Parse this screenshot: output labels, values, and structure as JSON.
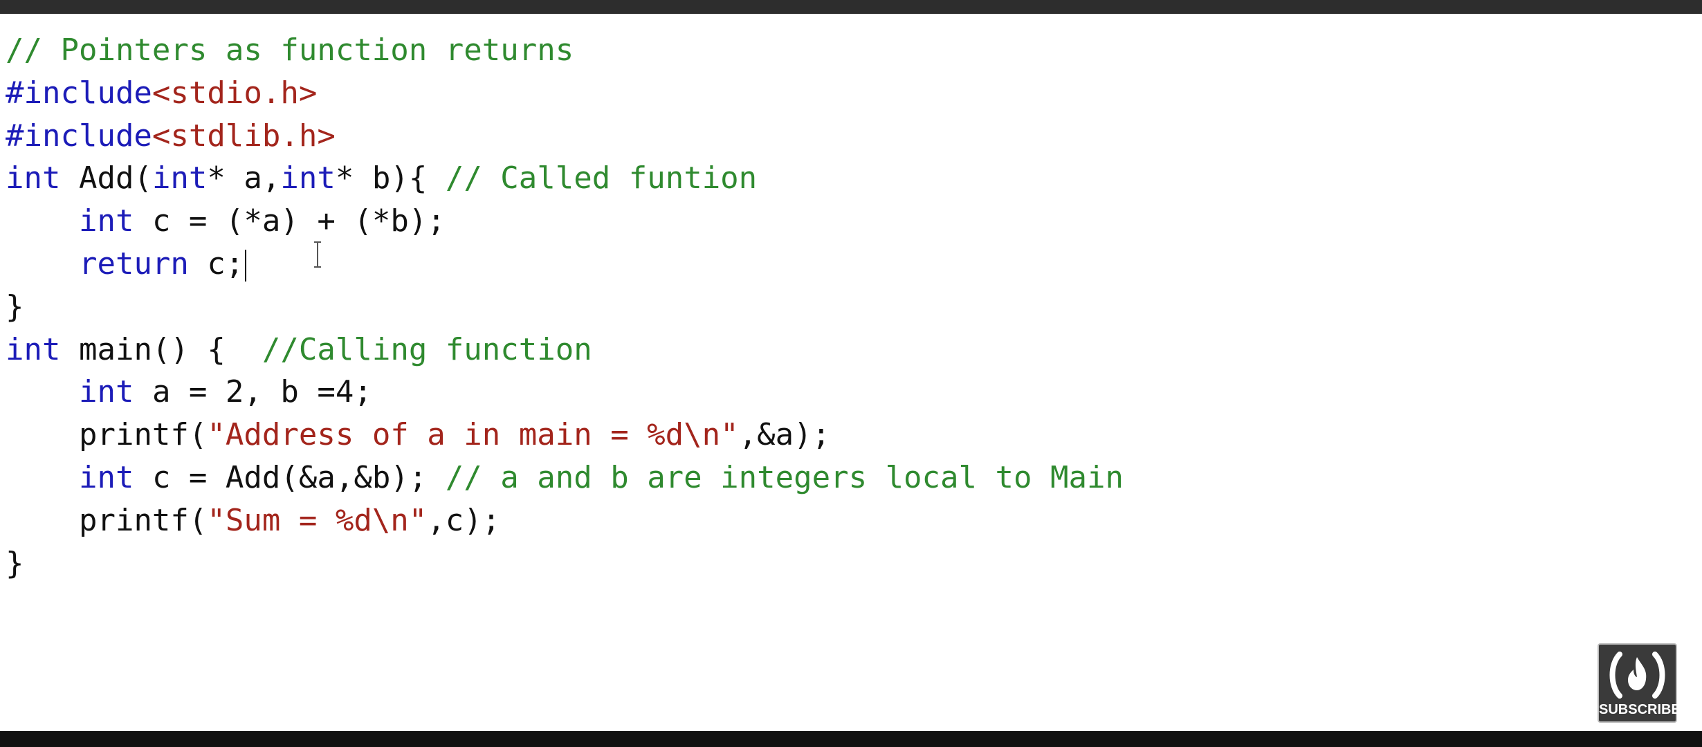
{
  "code": {
    "comment_header": "// Pointers as function returns",
    "include1_directive": "#include",
    "include1_file": "<stdio.h>",
    "include2_directive": "#include",
    "include2_file": "<stdlib.h>",
    "line4_kw1": "int",
    "line4_mid1": " Add(",
    "line4_kw2": "int",
    "line4_mid2": "* a,",
    "line4_kw3": "int",
    "line4_mid3": "* b){ ",
    "line4_comment": "// Called funtion",
    "line5_kw": "int",
    "line5_rest": " c = (*a) + (*b);",
    "line6_kw": "return",
    "line6_rest": " c;",
    "line7": "}",
    "line8_kw": "int",
    "line8_mid": " main() {  ",
    "line8_comment": "//Calling function",
    "line9_kw": "int",
    "line9_rest": " a = 2, b =4;",
    "line10_a": "printf(",
    "line10_str": "\"Address of a in main = %d\\n\"",
    "line10_b": ",&a);",
    "line11_kw": "int",
    "line11_mid": " c = Add(&a,&b); ",
    "line11_comment": "// a and b are integers local to Main",
    "line12_a": "printf(",
    "line12_str": "\"Sum = %d\\n\"",
    "line12_b": ",c);",
    "line13": "}"
  },
  "subscribe": {
    "label": "SUBSCRIBE",
    "icon": "flame-icon"
  }
}
